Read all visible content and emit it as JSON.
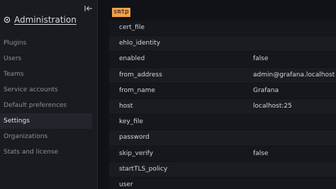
{
  "sidebar": {
    "title": "Administration",
    "collapse_icon": "dock-left-icon",
    "title_icon": "gear-icon",
    "items": [
      {
        "label": "Plugins"
      },
      {
        "label": "Users"
      },
      {
        "label": "Teams"
      },
      {
        "label": "Service accounts"
      },
      {
        "label": "Default preferences"
      },
      {
        "label": "Settings",
        "active": true
      },
      {
        "label": "Organizations"
      },
      {
        "label": "Stats and license"
      }
    ]
  },
  "settings": {
    "section": "smtp",
    "highlight_color": "#f2a34a",
    "rows": [
      {
        "key": "cert_file",
        "value": ""
      },
      {
        "key": "ehlo_identity",
        "value": ""
      },
      {
        "key": "enabled",
        "value": "false"
      },
      {
        "key": "from_address",
        "value": "admin@grafana.localhost"
      },
      {
        "key": "from_name",
        "value": "Grafana"
      },
      {
        "key": "host",
        "value": "localhost:25"
      },
      {
        "key": "key_file",
        "value": ""
      },
      {
        "key": "password",
        "value": ""
      },
      {
        "key": "skip_verify",
        "value": "false"
      },
      {
        "key": "startTLS_policy",
        "value": ""
      },
      {
        "key": "user",
        "value": ""
      }
    ]
  }
}
